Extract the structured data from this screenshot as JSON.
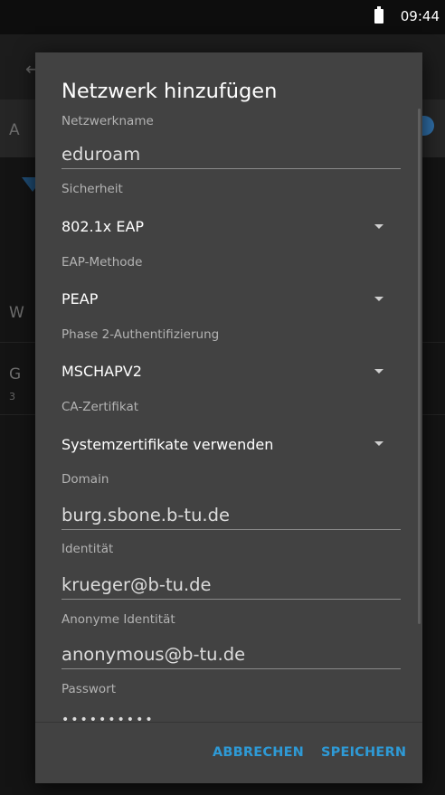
{
  "status_bar": {
    "time": "09:44",
    "battery_icon": "battery-icon"
  },
  "background": {
    "letters": {
      "a": "A",
      "w": "W",
      "g": "G"
    },
    "small_text": "3"
  },
  "dialog": {
    "title": "Netzwerk hinzufügen",
    "fields": {
      "network_name": {
        "label": "Netzwerkname",
        "value": "eduroam"
      },
      "security": {
        "label": "Sicherheit",
        "value": "802.1x EAP"
      },
      "eap_method": {
        "label": "EAP-Methode",
        "value": "PEAP"
      },
      "phase2": {
        "label": "Phase 2-Authentifizierung",
        "value": "MSCHAPV2"
      },
      "ca_cert": {
        "label": "CA-Zertifikat",
        "value": "Systemzertifikate verwenden"
      },
      "domain": {
        "label": "Domain",
        "value": "burg.sbone.b-tu.de"
      },
      "identity": {
        "label": "Identität",
        "value": "krueger@b-tu.de"
      },
      "anon_identity": {
        "label": "Anonyme Identität",
        "value": "anonymous@b-tu.de"
      },
      "password": {
        "label": "Passwort",
        "value": "••••••••••"
      }
    },
    "buttons": {
      "cancel": "ABBRECHEN",
      "save": "SPEICHERN"
    },
    "accent_color": "#2e9ad6"
  }
}
